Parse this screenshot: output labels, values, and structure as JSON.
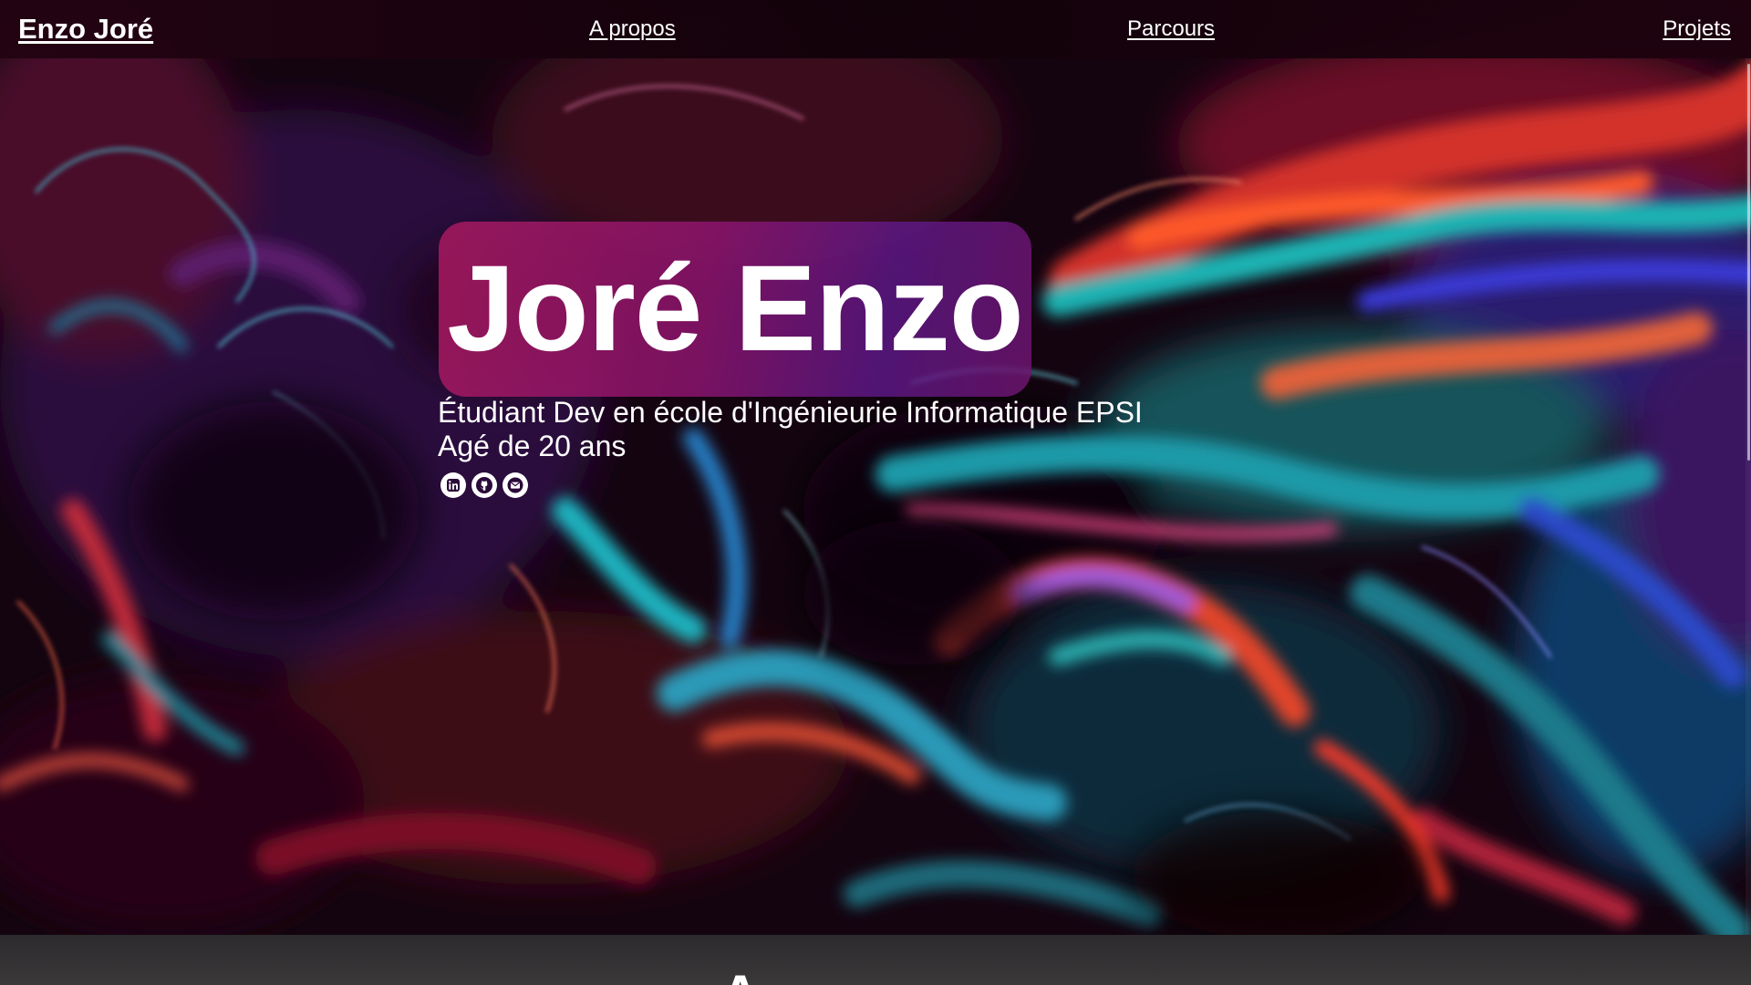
{
  "nav": {
    "brand": "Enzo Joré",
    "links": [
      {
        "label": "A propos"
      },
      {
        "label": "Parcours"
      },
      {
        "label": "Projets"
      }
    ]
  },
  "hero": {
    "name": "Joré Enzo",
    "subtitle_line1": "Étudiant Dev en école d'Ingénieurie Informatique EPSI",
    "subtitle_line2": "Agé de 20 ans",
    "socials": [
      {
        "icon": "linkedin-icon"
      },
      {
        "icon": "github-icon"
      },
      {
        "icon": "mail-icon"
      }
    ]
  },
  "next_section": {
    "heading_partial": "A"
  },
  "colors": {
    "name_box": "#a5195f",
    "nav_bg": "#17020b",
    "section_bg": "#323031",
    "text": "#ffffff"
  }
}
